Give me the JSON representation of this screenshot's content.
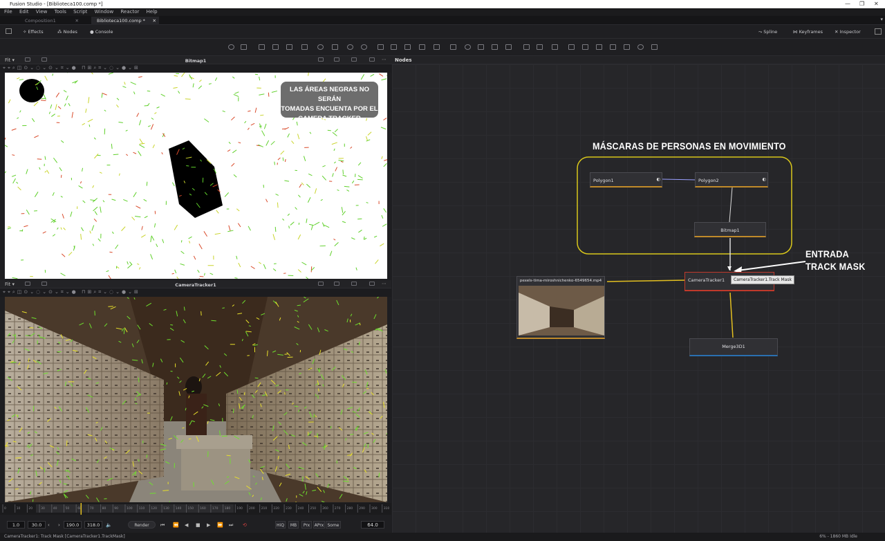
{
  "window": {
    "title": "Fusion Studio - [Biblioteca100.comp *]"
  },
  "menu": [
    "File",
    "Edit",
    "View",
    "Tools",
    "Script",
    "Window",
    "Reactor",
    "Help"
  ],
  "tabs": [
    {
      "label": "Composition1"
    },
    {
      "label": "Biblioteca100.comp *"
    }
  ],
  "toolbar": {
    "effects": "Effects",
    "nodes": "Nodes",
    "console": "Console",
    "spline": "Spline",
    "keyframes": "Keyframes",
    "inspector": "Inspector"
  },
  "viewer1": {
    "fit": "Fit",
    "title": "Bitmap1",
    "annotation": [
      "LAS ÁREAS NEGRAS NO SERÁN",
      "TOMADAS ENCUENTA POR EL",
      "CAMERA TRACKER"
    ]
  },
  "viewer2": {
    "fit": "Fit",
    "title": "CameraTracker1"
  },
  "nodes_panel": {
    "title": "Nodes"
  },
  "nodes": {
    "polygon1": "Polygon1",
    "polygon2": "Polygon2",
    "bitmap1": "Bitmap1",
    "loader": "pexels-tima-miroshnichenko-6549654.mp4",
    "cameratracker": "CameraTracker1",
    "merge": "Merge3D1",
    "tooltip": "CameraTracker1.Track Mask"
  },
  "annotations": {
    "mascaras": "MÁSCARAS DE PERSONAS EN MOVIMIENTO",
    "entrada_line1": "ENTRADA",
    "entrada_line2": "TRACK MASK"
  },
  "timeline": {
    "ticks": [
      "0",
      "10",
      "20",
      "30",
      "40",
      "50",
      "60",
      "70",
      "80",
      "90",
      "100",
      "110",
      "120",
      "130",
      "140",
      "150",
      "160",
      "170",
      "180",
      "190",
      "200",
      "210",
      "220",
      "230",
      "240",
      "250",
      "260",
      "270",
      "280",
      "290",
      "300",
      "310"
    ],
    "current": 64
  },
  "transport": {
    "start": "1.0",
    "render_start": "30.0",
    "render_end": "190.0",
    "end": "318.0",
    "render": "Render",
    "hiq": "HiQ",
    "mb": "MB",
    "prx": "Prx",
    "aprx": "APrx",
    "some": "Some",
    "current_frame": "64.0"
  },
  "status": {
    "left": "CameraTracker1: Track Mask   [CameraTracker1.TrackMask]",
    "right": "6% - 1860 MB   Idle"
  },
  "colors": {
    "accent": "#c08a2a",
    "mask_outline": "#d9c71a",
    "arrow_white": "#ffffff",
    "selected": "#c0392b"
  }
}
